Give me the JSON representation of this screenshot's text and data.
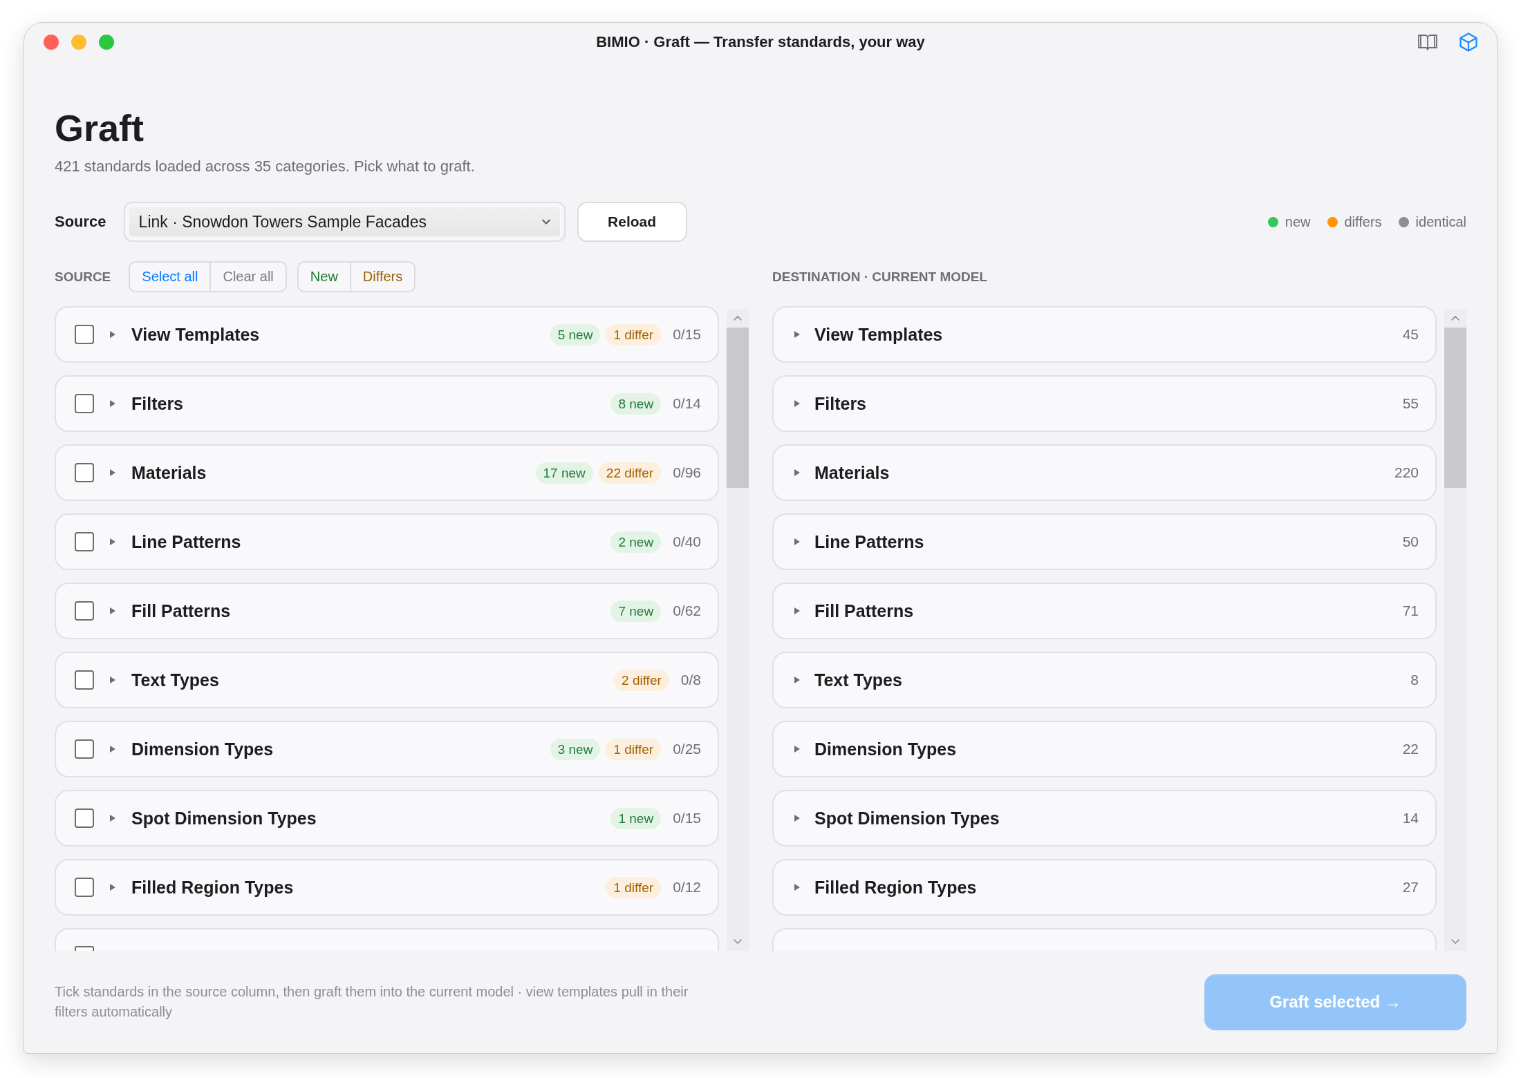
{
  "window": {
    "title": "BIMIO · Graft — Transfer standards, your way"
  },
  "header": {
    "title": "Graft",
    "subtitle": "421 standards loaded across 35 categories. Pick what to graft."
  },
  "source_picker": {
    "label": "Source",
    "value": "Link · Snowdon Towers Sample Facades",
    "reload": "Reload"
  },
  "legend": [
    {
      "label": "new",
      "color": "#34c759"
    },
    {
      "label": "differs",
      "color": "#ff9500"
    },
    {
      "label": "identical",
      "color": "#8e8e93"
    }
  ],
  "source": {
    "heading": "SOURCE",
    "actions": [
      {
        "label": "Select all",
        "kind": "primary"
      },
      {
        "label": "Clear all",
        "kind": "plain"
      }
    ],
    "filters": [
      {
        "label": "New",
        "kind": "new"
      },
      {
        "label": "Differs",
        "kind": "differs"
      }
    ],
    "rows": [
      {
        "name": "View Templates",
        "checked": false,
        "expanded": false,
        "badges": [
          {
            "kind": "new",
            "label": "5 new"
          },
          {
            "kind": "differ",
            "label": "1 differ"
          }
        ],
        "count": "0/15"
      },
      {
        "name": "Filters",
        "checked": false,
        "expanded": false,
        "badges": [
          {
            "kind": "new",
            "label": "8 new"
          }
        ],
        "count": "0/14"
      },
      {
        "name": "Materials",
        "checked": false,
        "expanded": false,
        "badges": [
          {
            "kind": "new",
            "label": "17 new"
          },
          {
            "kind": "differ",
            "label": "22 differ"
          }
        ],
        "count": "0/96"
      },
      {
        "name": "Line Patterns",
        "checked": false,
        "expanded": false,
        "badges": [
          {
            "kind": "new",
            "label": "2 new"
          }
        ],
        "count": "0/40"
      },
      {
        "name": "Fill Patterns",
        "checked": false,
        "expanded": false,
        "badges": [
          {
            "kind": "new",
            "label": "7 new"
          }
        ],
        "count": "0/62"
      },
      {
        "name": "Text Types",
        "checked": false,
        "expanded": false,
        "badges": [
          {
            "kind": "differ",
            "label": "2 differ"
          }
        ],
        "count": "0/8"
      },
      {
        "name": "Dimension Types",
        "checked": false,
        "expanded": false,
        "badges": [
          {
            "kind": "new",
            "label": "3 new"
          },
          {
            "kind": "differ",
            "label": "1 differ"
          }
        ],
        "count": "0/25"
      },
      {
        "name": "Spot Dimension Types",
        "checked": false,
        "expanded": false,
        "badges": [
          {
            "kind": "new",
            "label": "1 new"
          }
        ],
        "count": "0/15"
      },
      {
        "name": "Filled Region Types",
        "checked": false,
        "expanded": false,
        "badges": [
          {
            "kind": "differ",
            "label": "1 differ"
          }
        ],
        "count": "0/12"
      }
    ],
    "next_row": {
      "checked": false
    }
  },
  "destination": {
    "heading": "DESTINATION · CURRENT MODEL",
    "rows": [
      {
        "name": "View Templates",
        "expanded": false,
        "count": "45"
      },
      {
        "name": "Filters",
        "expanded": false,
        "count": "55"
      },
      {
        "name": "Materials",
        "expanded": false,
        "count": "220"
      },
      {
        "name": "Line Patterns",
        "expanded": false,
        "count": "50"
      },
      {
        "name": "Fill Patterns",
        "expanded": false,
        "count": "71"
      },
      {
        "name": "Text Types",
        "expanded": false,
        "count": "8"
      },
      {
        "name": "Dimension Types",
        "expanded": false,
        "count": "22"
      },
      {
        "name": "Spot Dimension Types",
        "expanded": false,
        "count": "14"
      },
      {
        "name": "Filled Region Types",
        "expanded": false,
        "count": "27"
      }
    ]
  },
  "footer": {
    "hint": "Tick standards in the source column, then graft them into the current model · view templates pull in their filters automatically",
    "action": {
      "label": "Graft selected →",
      "disabled": true
    }
  }
}
